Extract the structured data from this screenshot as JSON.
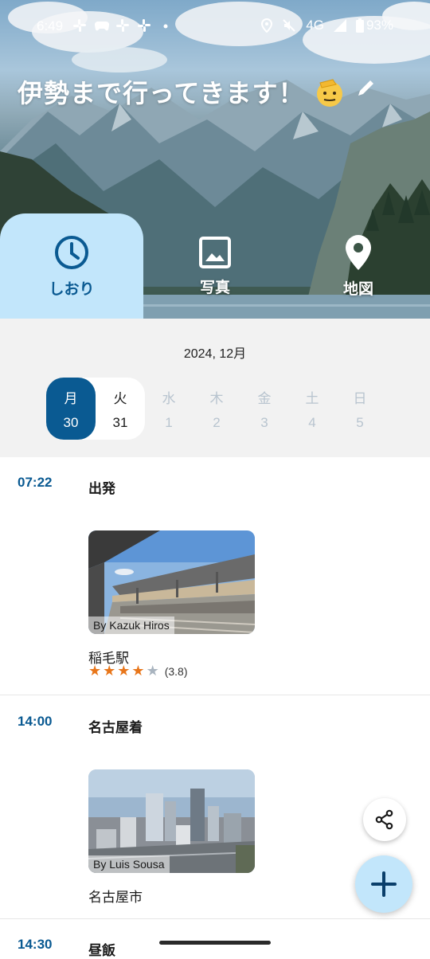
{
  "status_bar": {
    "time": "6:49",
    "network": "4G",
    "battery": "93%"
  },
  "trip": {
    "title": "伊勢まで行ってきます！",
    "emoji_icon": "saluting-face-emoji"
  },
  "tabs": [
    {
      "label": "しおり",
      "icon": "clock-icon",
      "active": true
    },
    {
      "label": "写真",
      "icon": "image-icon",
      "active": false
    },
    {
      "label": "地図",
      "icon": "location-pin-icon",
      "active": false
    }
  ],
  "calendar": {
    "month_label": "2024, 12月",
    "days": [
      {
        "weekday": "月",
        "date": "30",
        "state": "selected"
      },
      {
        "weekday": "火",
        "date": "31",
        "state": "in-trip"
      },
      {
        "weekday": "水",
        "date": "1",
        "state": "outside"
      },
      {
        "weekday": "木",
        "date": "2",
        "state": "outside"
      },
      {
        "weekday": "金",
        "date": "3",
        "state": "outside"
      },
      {
        "weekday": "土",
        "date": "4",
        "state": "outside"
      },
      {
        "weekday": "日",
        "date": "5",
        "state": "outside"
      }
    ]
  },
  "itinerary": [
    {
      "time": "07:22",
      "title": "出発",
      "photo_credit": "By Kazuk Hiros",
      "place": "稲毛駅",
      "rating_stars": 4,
      "rating_text": "(3.8)"
    },
    {
      "time": "14:00",
      "title": "名古屋着",
      "photo_credit": "By Luis Sousa",
      "place": "名古屋市"
    },
    {
      "time": "14:30",
      "title": "昼飯"
    }
  ],
  "colors": {
    "accent": "#0a5a92",
    "accent_light": "#c2e6fb",
    "star": "#e8761a",
    "calendar_bg": "#f2f2f2"
  },
  "fabs": {
    "share_icon": "share-icon",
    "add_icon": "plus-icon"
  }
}
